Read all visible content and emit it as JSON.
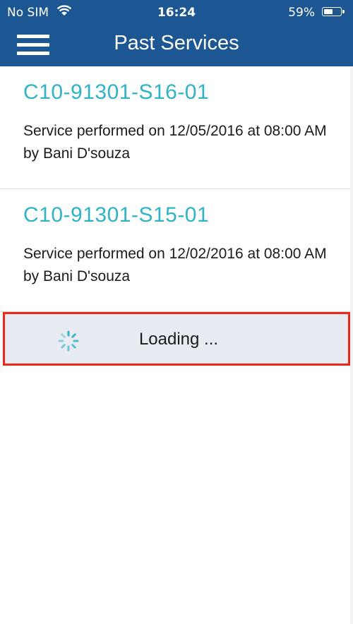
{
  "status_bar": {
    "carrier": "No SIM",
    "time": "16:24",
    "battery_percent": "59%",
    "battery_level": 0.59
  },
  "header": {
    "title": "Past Services",
    "menu_icon": "hamburger-menu-icon",
    "background_color": "#1d5793"
  },
  "services": [
    {
      "code": "C10-91301-S16-01",
      "description": "Service performed on 12/05/2016 at 08:00 AM by Bani D'souza"
    },
    {
      "code": "C10-91301-S15-01",
      "description": "Service performed on 12/02/2016 at 08:00 AM by Bani D'souza"
    }
  ],
  "loading": {
    "label": "Loading ...",
    "spinner_icon": "spinner-icon",
    "highlight_color": "#e8291a"
  },
  "colors": {
    "accent": "#2eb3c7",
    "loading_background": "#e8ebf1"
  }
}
